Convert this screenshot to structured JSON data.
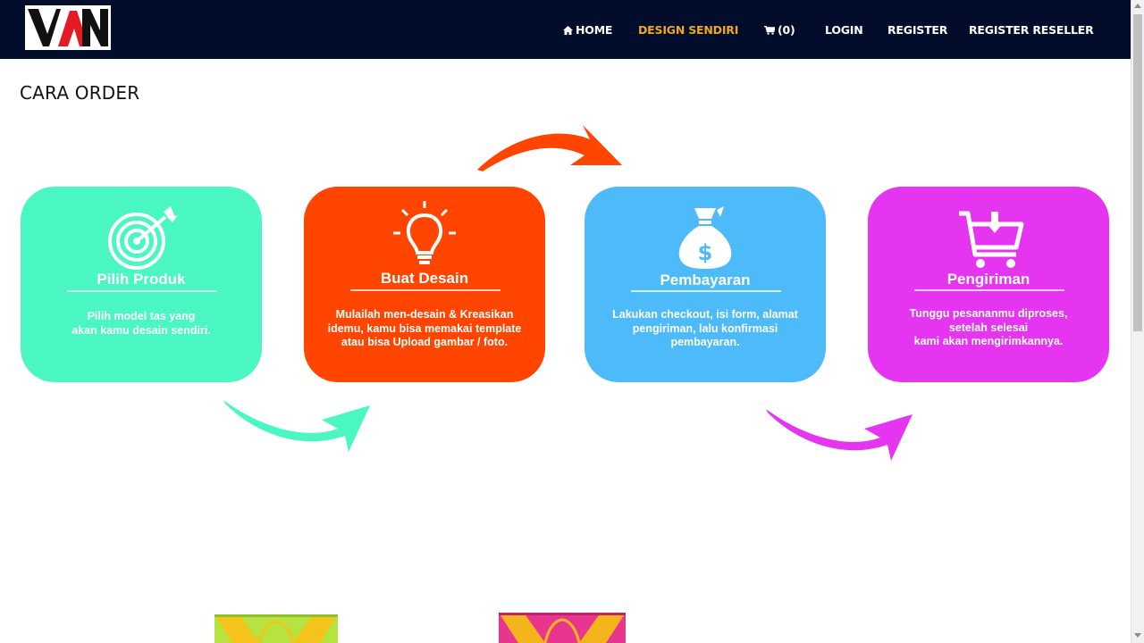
{
  "brand": {
    "logo_text": "VAN"
  },
  "nav": {
    "home": "HOME",
    "design": "DESIGN SENDIRI",
    "cart": "(0)",
    "login": "LOGIN",
    "register": "REGISTER",
    "register_reseller": "REGISTER RESELLER"
  },
  "page": {
    "title": "CARA ORDER"
  },
  "steps": [
    {
      "title": "Pilih Produk",
      "desc": "Pilih model tas yang\nakan kamu desain sendiri.",
      "icon": "target-icon",
      "color": "#4af7c2"
    },
    {
      "title": "Buat Desain",
      "desc": "Mulailah men-desain & Kreasikan\nidemu, kamu bisa memakai template\natau bisa Upload gambar / foto.",
      "icon": "lightbulb-icon",
      "color": "#ff4500"
    },
    {
      "title": "Pembayaran",
      "desc": "Lakukan checkout, isi form, alamat\npengiriman, lalu konfirmasi\npembayaran.",
      "icon": "money-bag-icon",
      "color": "#4dbaf9"
    },
    {
      "title": "Pengiriman",
      "desc": "Tunggu pesananmu diproses,\nsetelah selesai\nkami akan mengirimkannya.",
      "icon": "cart-download-icon",
      "color": "#e535f0"
    }
  ],
  "colors": {
    "navbar": "#020c2b",
    "nav_active": "#f0a91a",
    "arrow_green": "#4af7c2",
    "arrow_orange": "#ff4500",
    "arrow_magenta": "#e535f0"
  }
}
